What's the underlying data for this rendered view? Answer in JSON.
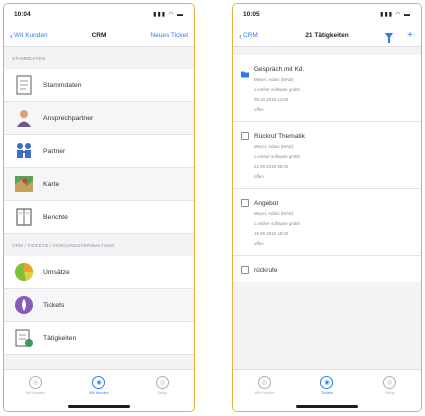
{
  "left": {
    "status": {
      "time": "10:04"
    },
    "navbar": {
      "back_label": "Wit Kunden",
      "title": "CRM",
      "action_label": "Neues Ticket"
    },
    "sections": [
      {
        "header": "STAMMDATEN",
        "items": [
          {
            "label": "Stammdaten",
            "icon": "document-icon"
          },
          {
            "label": "Ansprechpartner",
            "icon": "person-icon"
          },
          {
            "label": "Partner",
            "icon": "people-icon"
          },
          {
            "label": "Karte",
            "icon": "map-icon"
          },
          {
            "label": "Berichte",
            "icon": "book-icon"
          }
        ]
      },
      {
        "header": "CRM / TICKETS / VORGANGSVERWALTUNG",
        "items": [
          {
            "label": "Umsätze",
            "icon": "pie-chart-icon"
          },
          {
            "label": "Tickets",
            "icon": "ticket-icon"
          },
          {
            "label": "Tätigkeiten",
            "icon": "tasks-icon"
          }
        ]
      }
    ],
    "tabbar": [
      {
        "label": "Wit Kunden",
        "active": false
      },
      {
        "label": "Wit Kunden",
        "active": true
      },
      {
        "label": "Setup",
        "active": false
      }
    ]
  },
  "right": {
    "status": {
      "time": "10:05"
    },
    "navbar": {
      "back_label": "CRM",
      "title": "21 Tätigkeiten"
    },
    "activities": [
      {
        "title": "Gespräch mit Kd.",
        "icon": "folder-icon",
        "lines": [
          "Meyer, Adam (MAD)",
          "c.enther software gmbh",
          "09.10.2018 14:00",
          "offen"
        ]
      },
      {
        "title": "Rückruf Thematik",
        "icon": "checkbox-icon",
        "lines": [
          "Meyer, Adam (MAD)",
          "c.enther software gmbh",
          "22.09.2018 09:00",
          "offen"
        ]
      },
      {
        "title": "Angebot",
        "icon": "checkbox-icon",
        "lines": [
          "Meyer, Adam (MAD)",
          "c.enther software gmbh",
          "16.09.2018 15:00",
          "offen"
        ]
      },
      {
        "title": "rückrufe",
        "icon": "checkbox-icon",
        "lines": []
      }
    ],
    "tabbar": [
      {
        "label": "Wit Kunden",
        "active": false
      },
      {
        "label": "Tickets",
        "active": true
      },
      {
        "label": "Setup",
        "active": false
      }
    ]
  },
  "colors": {
    "accent": "#2f7bf0",
    "frame": "#e8b23a"
  }
}
